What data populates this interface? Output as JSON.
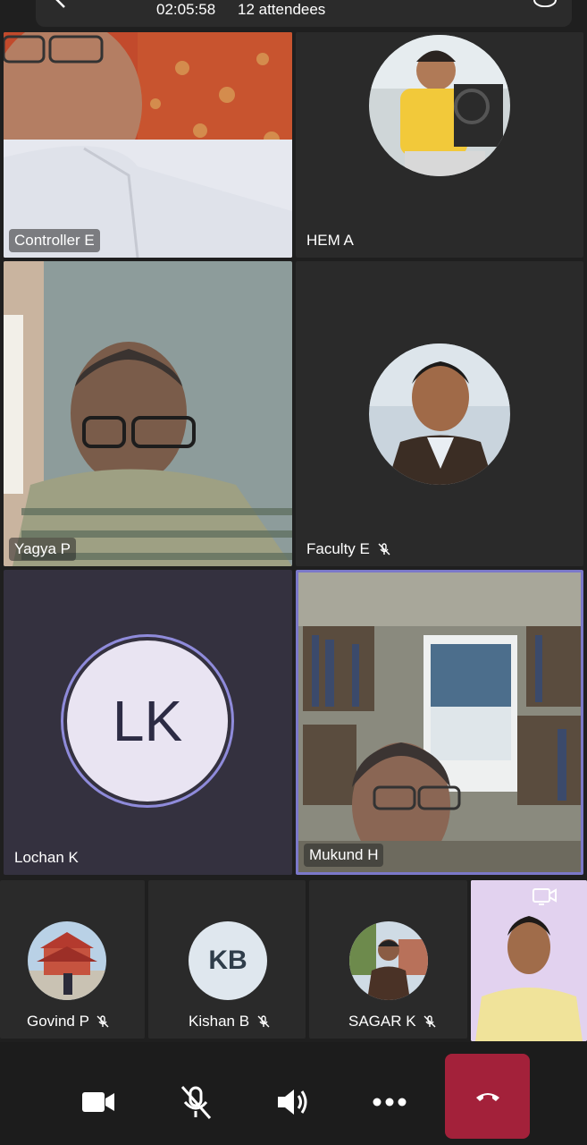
{
  "status": {
    "elapsed": "02:05:58",
    "attendees": "12 attendees"
  },
  "participants": [
    {
      "name": "Controller E",
      "type": "video",
      "muted": false
    },
    {
      "name": "HEM A",
      "type": "avatar-photo",
      "muted": false
    },
    {
      "name": "Yagya P",
      "type": "video",
      "muted": false
    },
    {
      "name": "Faculty E",
      "type": "avatar-photo",
      "muted": true
    },
    {
      "name": "Lochan K",
      "type": "initials",
      "initials": "LK",
      "muted": false
    },
    {
      "name": "Mukund H",
      "type": "video",
      "muted": false,
      "active_speaker": true
    }
  ],
  "strip": [
    {
      "name": "Govind P",
      "type": "avatar-photo",
      "muted": true
    },
    {
      "name": "Kishan B",
      "type": "initials",
      "initials": "KB",
      "muted": true
    },
    {
      "name": "SAGAR K",
      "type": "avatar-photo",
      "muted": true
    }
  ],
  "self_view": {
    "icon": "switch-camera-icon"
  },
  "controls": [
    {
      "name": "camera",
      "icon": "video-camera-icon"
    },
    {
      "name": "mic",
      "icon": "mic-off-icon"
    },
    {
      "name": "speaker",
      "icon": "speaker-icon"
    },
    {
      "name": "more",
      "icon": "more-dots-icon"
    },
    {
      "name": "end-call",
      "icon": "hang-up-icon"
    }
  ],
  "colors": {
    "background": "#1f1f1f",
    "tile": "#2a2a2a",
    "active_border": "#7b78c9",
    "end_call": "#a3213a",
    "initials_bg": "#e9e4f2"
  }
}
